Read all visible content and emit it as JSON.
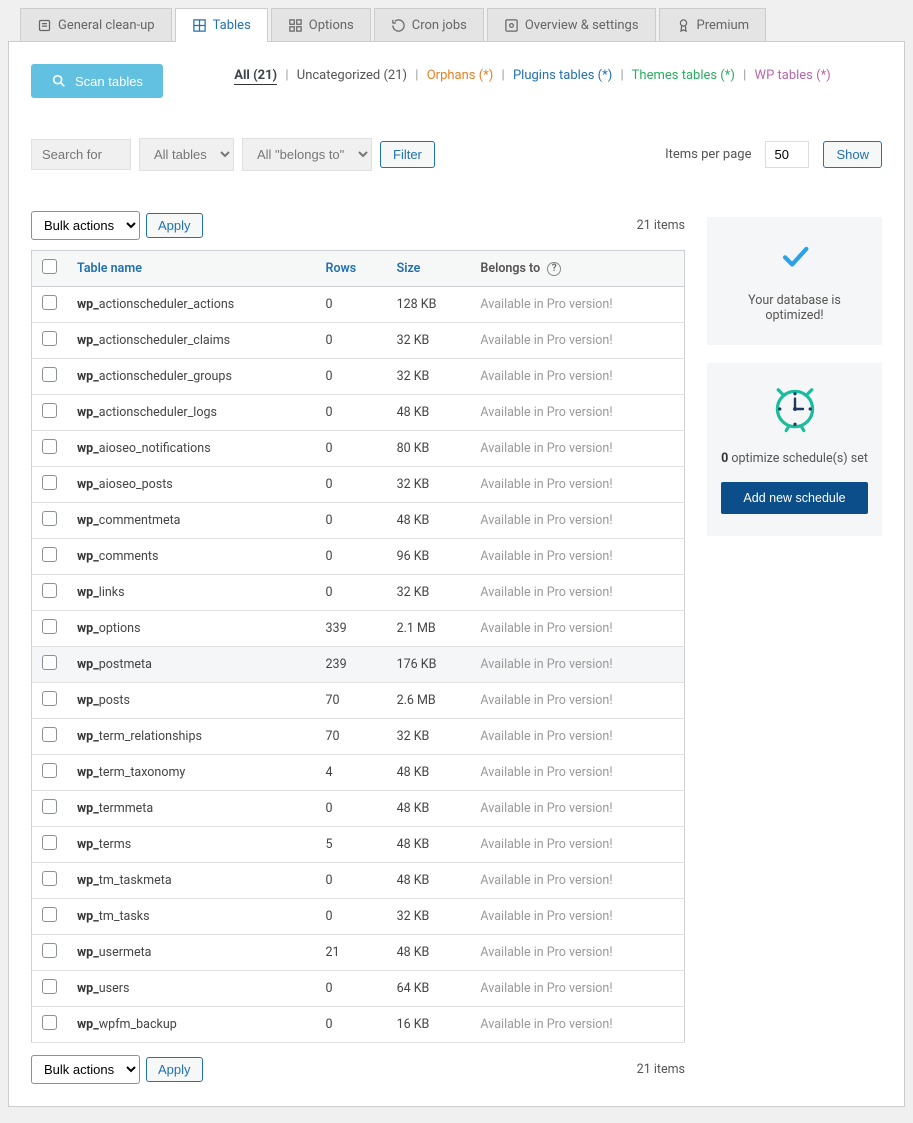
{
  "tabs": [
    {
      "label": "General clean-up"
    },
    {
      "label": "Tables"
    },
    {
      "label": "Options"
    },
    {
      "label": "Cron jobs"
    },
    {
      "label": "Overview & settings"
    },
    {
      "label": "Premium"
    }
  ],
  "scan_label": "Scan tables",
  "filter_links": {
    "all": "All (21)",
    "uncat": "Uncategorized (21)",
    "orphans": "Orphans (*)",
    "plugins": "Plugins tables (*)",
    "themes": "Themes tables (*)",
    "wp": "WP tables (*)"
  },
  "search_placeholder": "Search for",
  "dd_tables": "All tables",
  "dd_belongs": "All \"belongs to\"",
  "filter_btn": "Filter",
  "ipp_label": "Items per page",
  "ipp_value": "50",
  "show_btn": "Show",
  "bulk_label": "Bulk actions",
  "apply_label": "Apply",
  "items_count": "21 items",
  "headers": {
    "table": "Table name",
    "rows": "Rows",
    "size": "Size",
    "belongs": "Belongs to"
  },
  "pro_text": "Available in Pro version!",
  "rows": [
    {
      "prefix": "wp_",
      "name": "actionscheduler_actions",
      "rows": "0",
      "size": "128 KB",
      "hl": false
    },
    {
      "prefix": "wp_",
      "name": "actionscheduler_claims",
      "rows": "0",
      "size": "32 KB",
      "hl": false
    },
    {
      "prefix": "wp_",
      "name": "actionscheduler_groups",
      "rows": "0",
      "size": "32 KB",
      "hl": false
    },
    {
      "prefix": "wp_",
      "name": "actionscheduler_logs",
      "rows": "0",
      "size": "48 KB",
      "hl": false
    },
    {
      "prefix": "wp_",
      "name": "aioseo_notifications",
      "rows": "0",
      "size": "80 KB",
      "hl": false
    },
    {
      "prefix": "wp_",
      "name": "aioseo_posts",
      "rows": "0",
      "size": "32 KB",
      "hl": false
    },
    {
      "prefix": "wp_",
      "name": "commentmeta",
      "rows": "0",
      "size": "48 KB",
      "hl": false
    },
    {
      "prefix": "wp_",
      "name": "comments",
      "rows": "0",
      "size": "96 KB",
      "hl": false
    },
    {
      "prefix": "wp_",
      "name": "links",
      "rows": "0",
      "size": "32 KB",
      "hl": false
    },
    {
      "prefix": "wp_",
      "name": "options",
      "rows": "339",
      "size": "2.1 MB",
      "hl": false
    },
    {
      "prefix": "wp_",
      "name": "postmeta",
      "rows": "239",
      "size": "176 KB",
      "hl": true
    },
    {
      "prefix": "wp_",
      "name": "posts",
      "rows": "70",
      "size": "2.6 MB",
      "hl": false
    },
    {
      "prefix": "wp_",
      "name": "term_relationships",
      "rows": "70",
      "size": "32 KB",
      "hl": false
    },
    {
      "prefix": "wp_",
      "name": "term_taxonomy",
      "rows": "4",
      "size": "48 KB",
      "hl": false
    },
    {
      "prefix": "wp_",
      "name": "termmeta",
      "rows": "0",
      "size": "48 KB",
      "hl": false
    },
    {
      "prefix": "wp_",
      "name": "terms",
      "rows": "5",
      "size": "48 KB",
      "hl": false
    },
    {
      "prefix": "wp_",
      "name": "tm_taskmeta",
      "rows": "0",
      "size": "48 KB",
      "hl": false
    },
    {
      "prefix": "wp_",
      "name": "tm_tasks",
      "rows": "0",
      "size": "32 KB",
      "hl": false
    },
    {
      "prefix": "wp_",
      "name": "usermeta",
      "rows": "21",
      "size": "48 KB",
      "hl": false
    },
    {
      "prefix": "wp_",
      "name": "users",
      "rows": "0",
      "size": "64 KB",
      "hl": false
    },
    {
      "prefix": "wp_",
      "name": "wpfm_backup",
      "rows": "0",
      "size": "16 KB",
      "hl": false
    }
  ],
  "right": {
    "optimized": "Your database is optimized!",
    "schedules_count": "0",
    "schedules_text": "optimize schedule(s) set",
    "add_schedule": "Add new schedule"
  }
}
